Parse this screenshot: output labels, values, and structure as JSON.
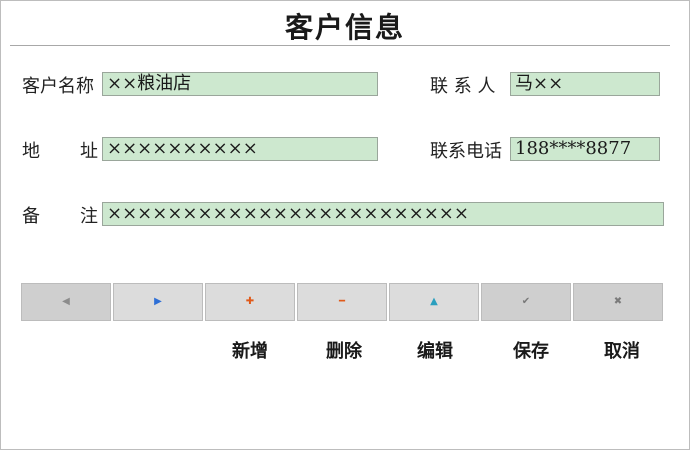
{
  "title": "客户信息",
  "form": {
    "customer_name_label": "客户名称",
    "customer_name_value": "××粮油店",
    "contact_label": "联 系 人",
    "contact_value": "马××",
    "address_label_1": "地",
    "address_label_2": "址",
    "address_value": "××××××××××",
    "phone_label": "联系电话",
    "phone_value": "188****8877",
    "note_label_1": "备",
    "note_label_2": "注",
    "note_value": "××××××××××××××××××××××××"
  },
  "toolbar": {
    "buttons": [
      {
        "icon": "◀",
        "color": "#8c8c8c"
      },
      {
        "icon": "▶",
        "color": "#2e6fd6"
      },
      {
        "icon": "✚",
        "color": "#e05a1a"
      },
      {
        "icon": "━",
        "color": "#e05a1a"
      },
      {
        "icon": "▲",
        "color": "#2a9fbf"
      },
      {
        "icon": "✔",
        "color": "#7a7a7a"
      },
      {
        "icon": "✖",
        "color": "#7a7a7a"
      }
    ],
    "captions": {
      "add": "新增",
      "delete": "删除",
      "edit": "编辑",
      "save": "保存",
      "cancel": "取消"
    }
  }
}
